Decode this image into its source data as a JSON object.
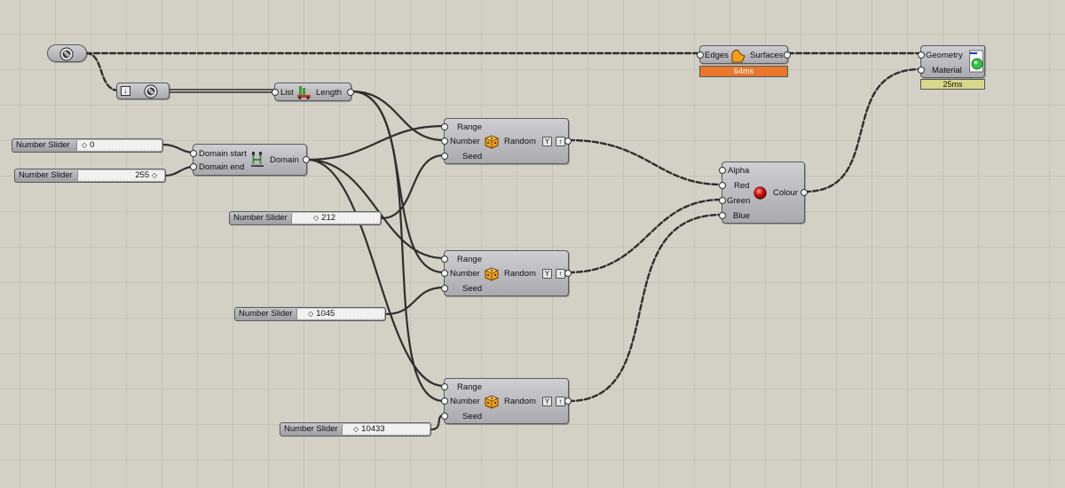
{
  "canvas": {
    "background": "#d3d0c6"
  },
  "nodes": {
    "list_length": {
      "input": "List",
      "output": "Length"
    },
    "domain": {
      "inputs": [
        "Domain start",
        "Domain end"
      ],
      "output": "Domain"
    },
    "random1": {
      "inputs": [
        "Range",
        "Number",
        "Seed"
      ],
      "output": "Random"
    },
    "random2": {
      "inputs": [
        "Range",
        "Number",
        "Seed"
      ],
      "output": "Random"
    },
    "random3": {
      "inputs": [
        "Range",
        "Number",
        "Seed"
      ],
      "output": "Random"
    },
    "colour": {
      "inputs": [
        "Alpha",
        "Red",
        "Green",
        "Blue"
      ],
      "output": "Colour"
    },
    "edge_surf": {
      "input": "Edges",
      "output": "Surfaces",
      "time": "64ms",
      "time_color": "#e8762c"
    },
    "preview": {
      "inputs": [
        "Geometry",
        "Material"
      ],
      "time": "25ms",
      "time_color": "#d9d78a"
    }
  },
  "sliders": [
    {
      "name": "Number Slider",
      "value": "0"
    },
    {
      "name": "Number Slider",
      "value": "255"
    },
    {
      "name": "Number Slider",
      "value": "212"
    },
    {
      "name": "Number Slider",
      "value": "1045"
    },
    {
      "name": "Number Slider",
      "value": "10433"
    }
  ],
  "icons": {
    "brep": "brep-icon",
    "flatten": "flatten-icon",
    "list_length": "list-length-icon",
    "domain": "domain-icon",
    "random": "random-dice-icon",
    "colour": "colour-swatch-icon",
    "edge_surf": "edge-surface-icon",
    "preview": "custom-preview-icon"
  },
  "flags": {
    "graft": "Y",
    "simplify": "↑"
  }
}
